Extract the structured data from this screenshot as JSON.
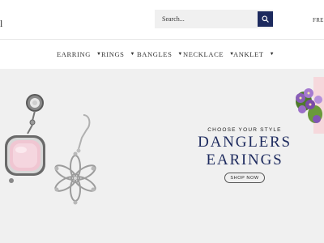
{
  "header": {
    "logo_fragment": "l",
    "search": {
      "placeholder": "Search..."
    },
    "free_text": "FREE"
  },
  "nav": {
    "items": [
      {
        "label": "EARRING"
      },
      {
        "label": "RINGS"
      },
      {
        "label": "BANGLES"
      },
      {
        "label": "NECKLACE"
      },
      {
        "label": "ANKLET"
      }
    ]
  },
  "hero": {
    "kicker": "CHOOSE YOUR STYLE",
    "title_line1": "DANGLERS",
    "title_line2": "EARINGS",
    "cta": "SHOP NOW"
  },
  "colors": {
    "brand_navy": "#1d2a5e",
    "hero_bg": "#f0f0f0",
    "search_bg": "#f0f0f0"
  },
  "icons": {
    "search": "search-icon",
    "caret": "caret-down-icon"
  }
}
